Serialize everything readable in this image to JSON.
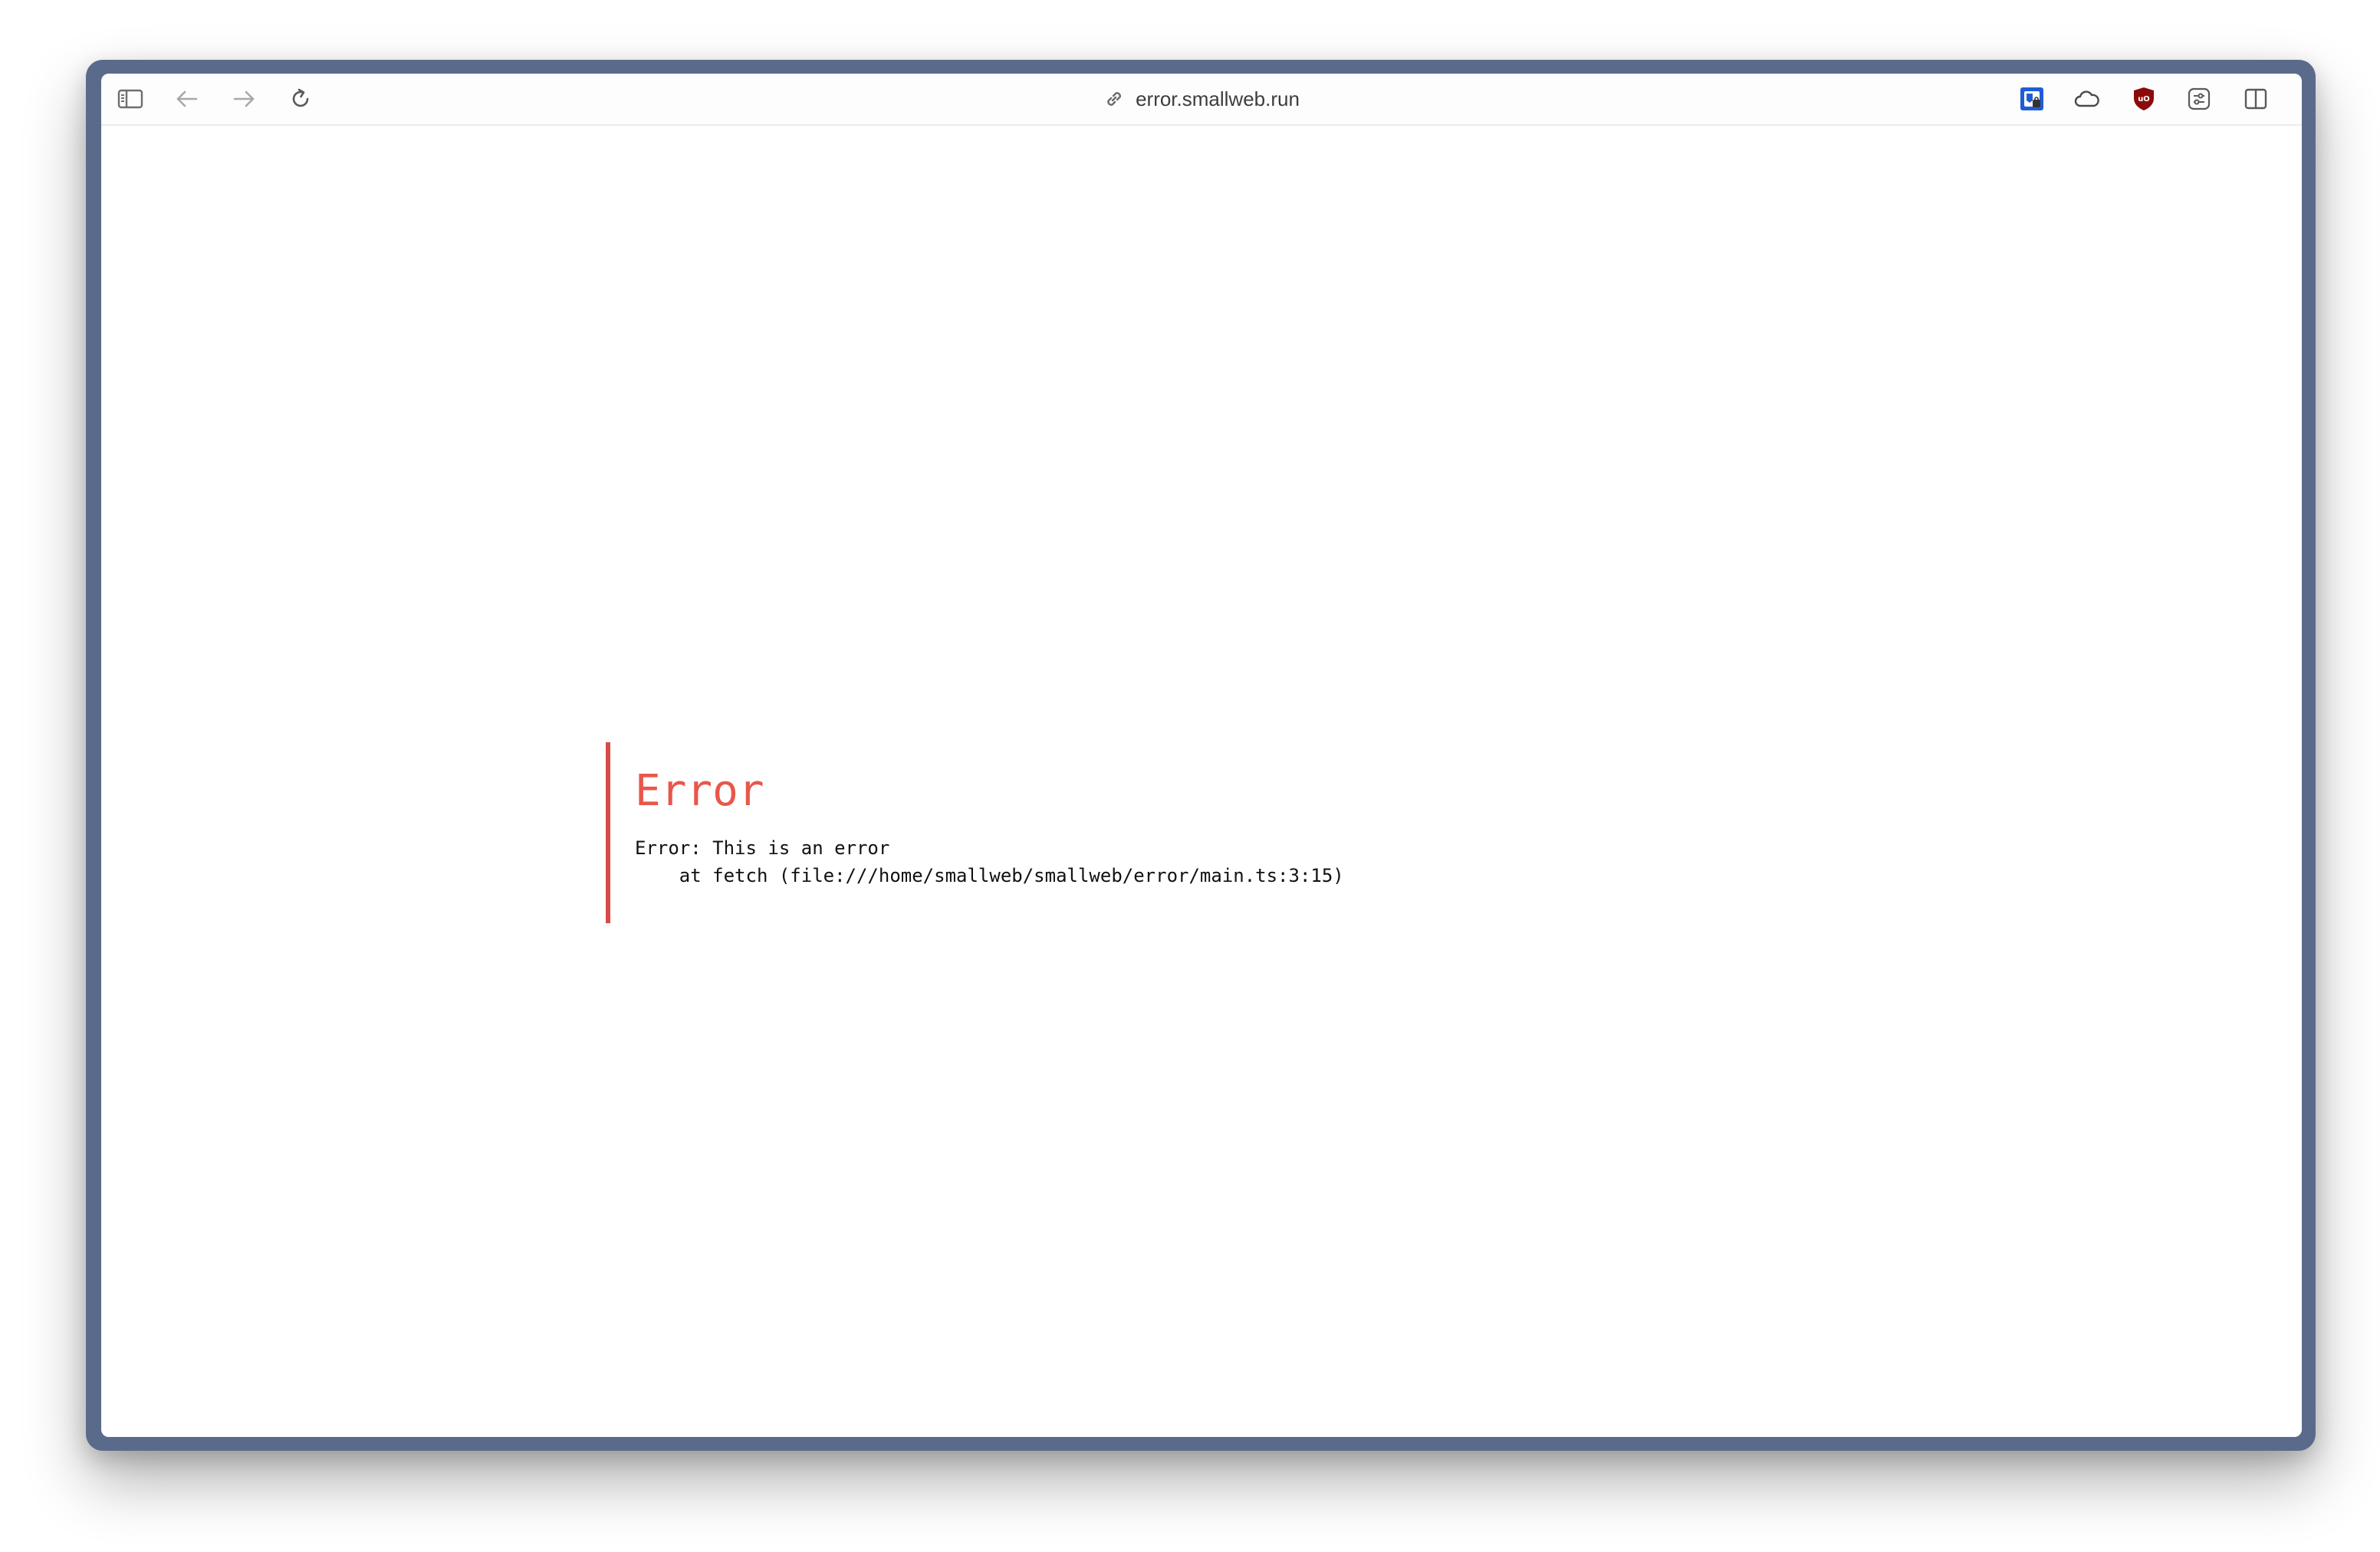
{
  "browser": {
    "address": "error.smallweb.run",
    "icons": {
      "sidebar": "sidebar-icon",
      "back": "back-arrow-icon",
      "forward": "forward-arrow-icon",
      "reload": "reload-icon",
      "link": "link-icon",
      "ext_bitwarden": "password-manager-extension-icon",
      "ext_cloud": "cloud-extension-icon",
      "ext_ublock": "ublock-origin-extension-icon",
      "ext_settings": "extension-settings-icon",
      "split_view": "split-view-icon"
    },
    "colors": {
      "window_frame": "#5a6a8a",
      "error_accent": "#d94b4b",
      "error_title": "#e8574a"
    }
  },
  "page": {
    "error_title": "Error",
    "error_message": "Error: This is an error",
    "stack_line": "    at fetch (file:///home/smallweb/smallweb/error/main.ts:3:15)"
  }
}
